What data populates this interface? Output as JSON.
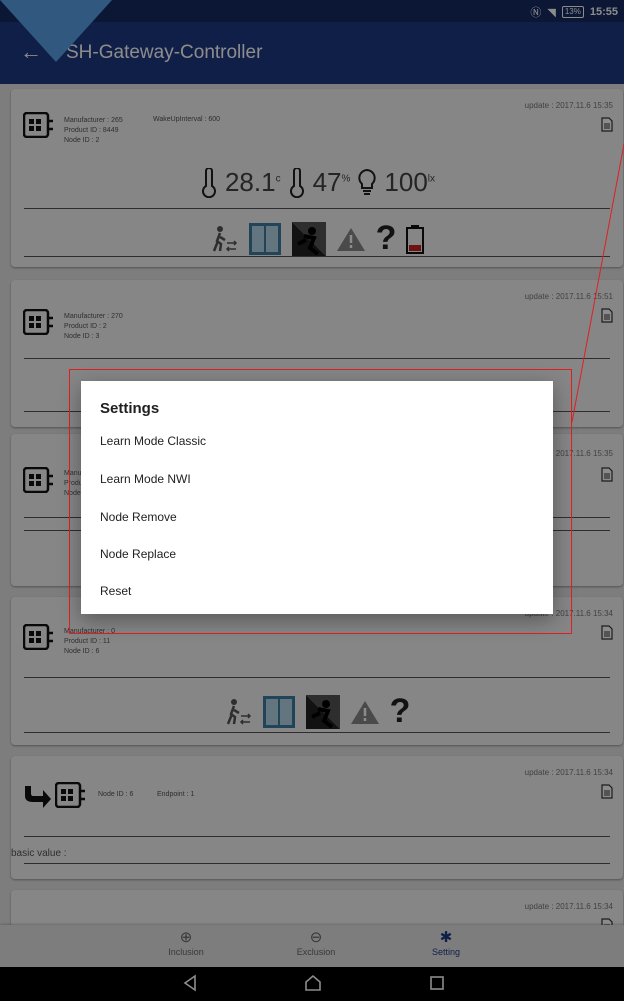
{
  "status_bar": {
    "battery": "13%",
    "time": "15:55"
  },
  "app_bar": {
    "title": "SH-Gateway-Controller",
    "back_icon": "arrow-left-icon"
  },
  "cards": [
    {
      "update": "update : 2017.11.6 15:35",
      "info_lines": [
        "Manufacturer : 265",
        "Product ID : 8449",
        "Node ID : 2"
      ],
      "extra": "WakeUpInterval : 600",
      "temperature": "28.1",
      "temperature_unit": "c",
      "humidity": "47",
      "humidity_unit": "%",
      "lux": "100",
      "lux_unit": "lx"
    },
    {
      "update": "update : 2017.11.6 15:51",
      "info_lines": [
        "Manufacturer : 270",
        "Product ID : 2",
        "Node ID : 3"
      ]
    },
    {
      "update": "update : 2017.11.6 15:35",
      "info_lines": [
        "Manufacturer",
        "Product",
        "Node"
      ]
    },
    {
      "update": "update : 2017.11.6 15:34",
      "info_lines": [
        "Manufacturer : 0",
        "Product ID : 11",
        "Node ID : 6"
      ]
    },
    {
      "update": "update : 2017.11.6 15:34",
      "node": "Node ID : 6",
      "endpoint": "Endpoint : 1",
      "basic_value": "basic value :"
    },
    {
      "update": "update : 2017.11.6 15:34"
    }
  ],
  "dialog": {
    "title": "Settings",
    "items": [
      "Learn Mode Classic",
      "Learn Mode NWI",
      "Node Remove",
      "Node Replace",
      "Reset"
    ]
  },
  "bottom_nav": {
    "inclusion": "Inclusion",
    "exclusion": "Exclusion",
    "setting": "Setting",
    "active": "Setting"
  },
  "colors": {
    "app_bar": "#1e3a82",
    "status_bar": "#152b62",
    "accent": "#1e3a82",
    "annotation": "#e02020"
  }
}
